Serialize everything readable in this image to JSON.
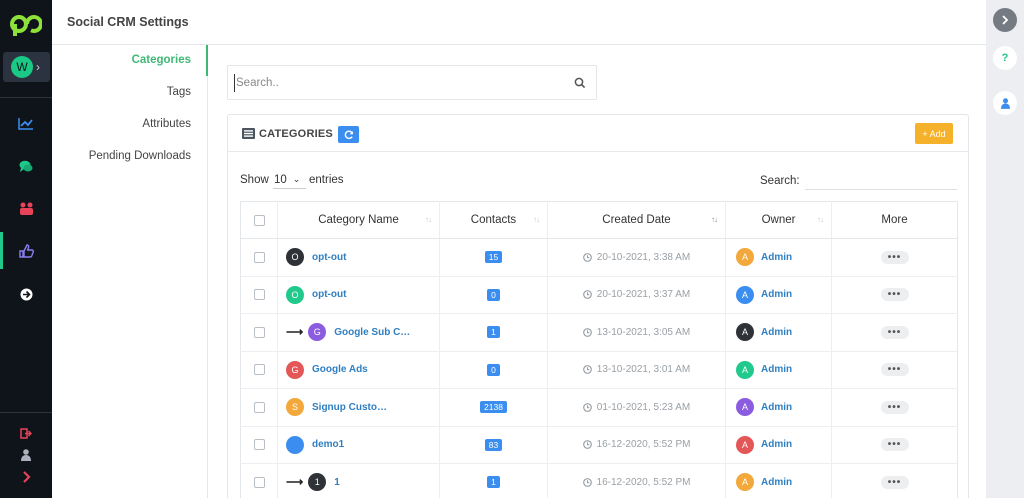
{
  "app": {
    "title": "Social CRM Settings",
    "workspace_initial": "W"
  },
  "settings_menu": [
    {
      "label": "Categories",
      "active": true
    },
    {
      "label": "Tags",
      "active": false
    },
    {
      "label": "Attributes",
      "active": false
    },
    {
      "label": "Pending Downloads",
      "active": false
    }
  ],
  "search": {
    "placeholder": "Search.."
  },
  "card": {
    "title": "CATEGORIES",
    "add_label": "+ Add",
    "show_label": "Show",
    "entries_value": "10",
    "entries_label": "entries",
    "search_label": "Search:"
  },
  "table": {
    "headers": [
      "Category Name",
      "Contacts",
      "Created Date",
      "Owner",
      "More"
    ],
    "rows": [
      {
        "indent": false,
        "initial": "O",
        "avatar_color": "#2f3338",
        "name": "opt-out",
        "contacts": "15",
        "date": "20-10-2021, 3:38 AM",
        "owner_initial": "A",
        "owner_color": "#f2a83a",
        "owner": "Admin"
      },
      {
        "indent": false,
        "initial": "O",
        "avatar_color": "#21c98d",
        "name": "opt-out",
        "contacts": "0",
        "date": "20-10-2021, 3:37 AM",
        "owner_initial": "A",
        "owner_color": "#3b8ef0",
        "owner": "Admin"
      },
      {
        "indent": true,
        "initial": "G",
        "avatar_color": "#8b5ce0",
        "name": "Google Sub C…",
        "contacts": "1",
        "date": "13-10-2021, 3:05 AM",
        "owner_initial": "A",
        "owner_color": "#2f3338",
        "owner": "Admin"
      },
      {
        "indent": false,
        "initial": "G",
        "avatar_color": "#e45757",
        "name": "Google Ads",
        "contacts": "0",
        "date": "13-10-2021, 3:01 AM",
        "owner_initial": "A",
        "owner_color": "#21c98d",
        "owner": "Admin"
      },
      {
        "indent": false,
        "initial": "S",
        "avatar_color": "#f2a83a",
        "name": "Signup Custo…",
        "contacts": "2138",
        "date": "01-10-2021, 5:23 AM",
        "owner_initial": "A",
        "owner_color": "#8b5ce0",
        "owner": "Admin"
      },
      {
        "indent": false,
        "initial": "",
        "avatar_color": "#3b8ef0",
        "name": "demo1",
        "contacts": "83",
        "date": "16-12-2020, 5:52 PM",
        "owner_initial": "A",
        "owner_color": "#e45757",
        "owner": "Admin"
      },
      {
        "indent": true,
        "initial": "1",
        "avatar_color": "#2f3338",
        "name": "1",
        "contacts": "1",
        "date": "16-12-2020, 5:52 PM",
        "owner_initial": "A",
        "owner_color": "#f2a83a",
        "owner": "Admin"
      }
    ]
  },
  "colors": {
    "accent_green": "#3fb876",
    "link_blue": "#2f7fc1",
    "primary_blue": "#3b8ef0",
    "add_orange": "#f6b12b",
    "sidebar_dark": "#0f141b"
  },
  "icons": {
    "nav": [
      "chart-line-icon",
      "chat-icon",
      "users-icon",
      "thumbs-up-icon",
      "arrow-circle-right-icon"
    ],
    "bottom": [
      "logout-icon",
      "user-icon",
      "chevron-right-icon"
    ],
    "right": [
      "chevron-right-icon",
      "help-icon",
      "user-icon"
    ]
  }
}
